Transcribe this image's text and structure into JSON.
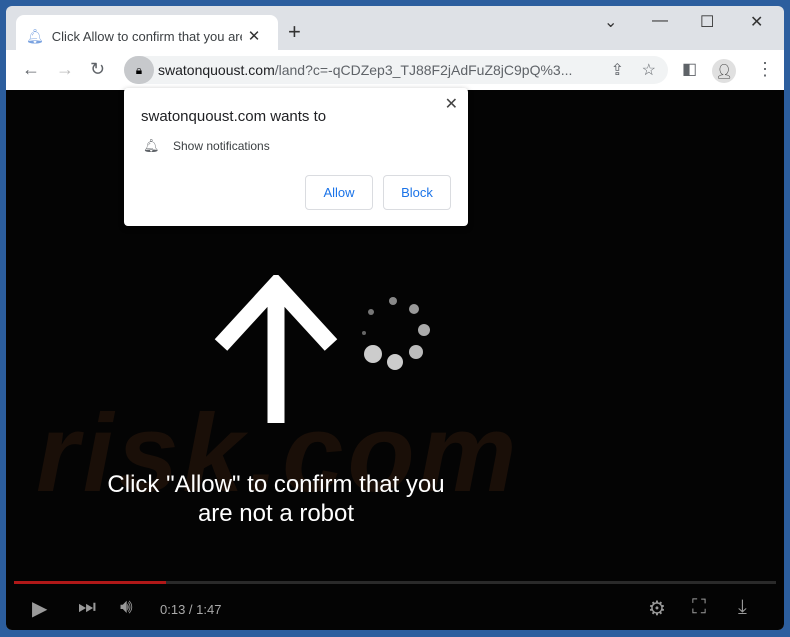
{
  "tab": {
    "title": "Click Allow to confirm that you are not a robot",
    "icon": "bell-favicon"
  },
  "window_controls": {
    "dropdown": "⌄",
    "minimize": "—",
    "maximize": "☐",
    "close": "✕"
  },
  "address": {
    "domain": "swatonquoust.com",
    "path": "/land?c=-qCDZep3_TJ88F2jAdFuZ8jC9pQ%3..."
  },
  "popup": {
    "heading": "swatonquoust.com wants to",
    "permission": "Show notifications",
    "allow": "Allow",
    "block": "Block"
  },
  "message": {
    "line1": "Click \"Allow\" to confirm that you",
    "line2": "are not a robot"
  },
  "watermark": "risk.com",
  "player": {
    "time": "0:13 / 1:47",
    "progress_fraction": 0.2,
    "progress_color": "#b01818"
  },
  "colors": {
    "frame": "#2c5e9e",
    "accent": "#1a73e8"
  }
}
